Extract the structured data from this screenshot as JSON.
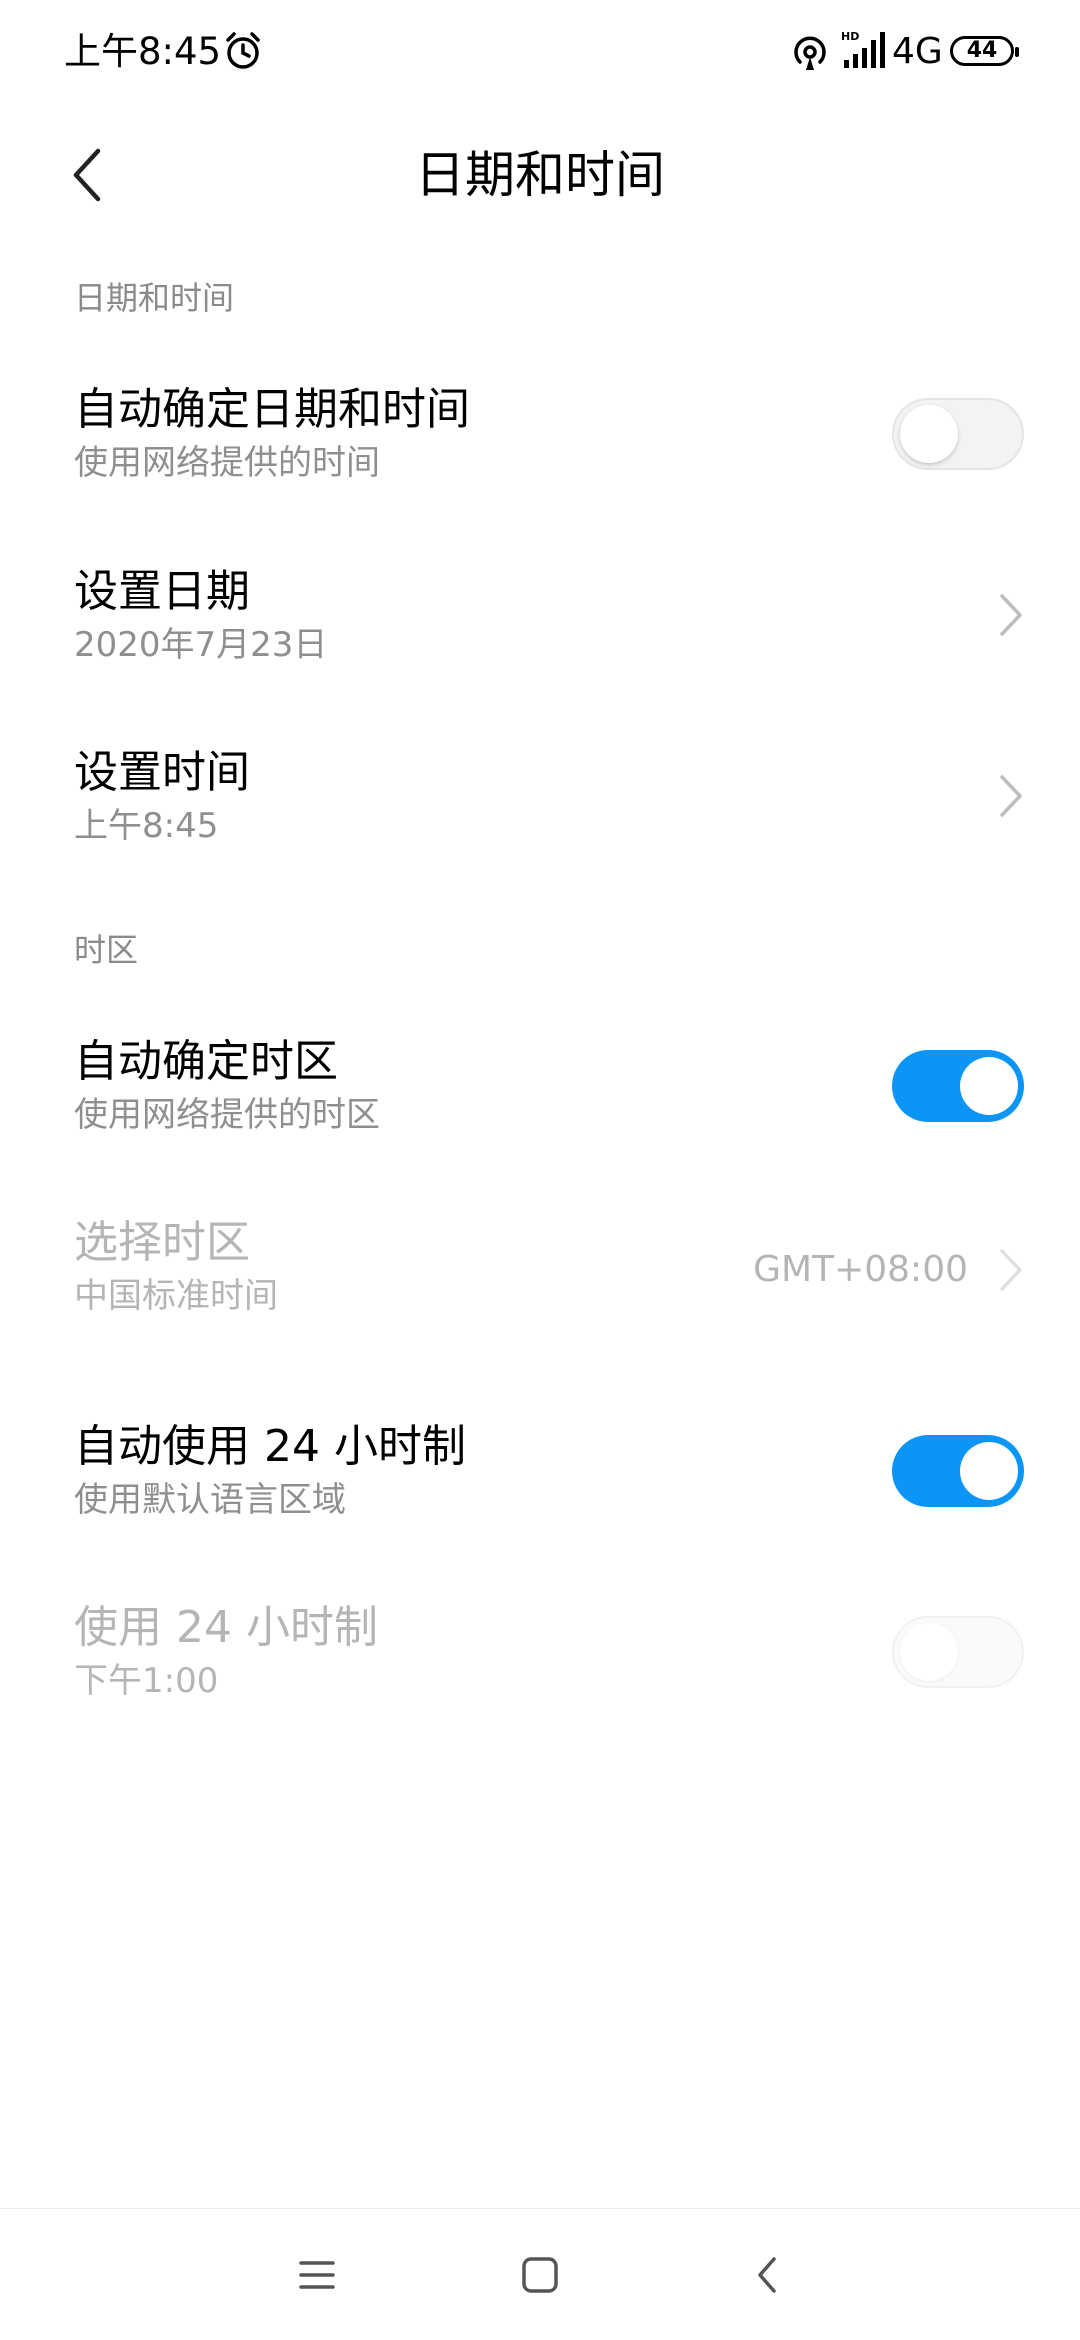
{
  "status_bar": {
    "time": "上午8:45",
    "network_type": "4G",
    "battery_level": "44",
    "icons": [
      "alarm-icon",
      "hotspot-icon",
      "hd-signal-icon"
    ]
  },
  "header": {
    "title": "日期和时间",
    "back_icon": "chevron-left-icon"
  },
  "sections": [
    {
      "label": "日期和时间",
      "items": [
        {
          "title": "自动确定日期和时间",
          "subtitle": "使用网络提供的时间",
          "control": "toggle",
          "toggle_on": false,
          "enabled": true
        },
        {
          "title": "设置日期",
          "subtitle": "2020年7月23日",
          "control": "chevron",
          "enabled": true
        },
        {
          "title": "设置时间",
          "subtitle": "上午8:45",
          "control": "chevron",
          "enabled": true
        }
      ]
    },
    {
      "label": "时区",
      "items": [
        {
          "title": "自动确定时区",
          "subtitle": "使用网络提供的时区",
          "control": "toggle",
          "toggle_on": true,
          "enabled": true
        },
        {
          "title": "选择时区",
          "subtitle": "中国标准时间",
          "value": "GMT+08:00",
          "control": "chevron",
          "enabled": false
        }
      ]
    },
    {
      "label": "",
      "items": [
        {
          "title": "自动使用 24 小时制",
          "subtitle": "使用默认语言区域",
          "control": "toggle",
          "toggle_on": true,
          "enabled": true
        },
        {
          "title": "使用 24 小时制",
          "subtitle": "下午1:00",
          "control": "toggle",
          "toggle_on": false,
          "enabled": false
        }
      ]
    }
  ],
  "nav_bar": {
    "icons": [
      "menu-icon",
      "home-icon",
      "back-icon"
    ]
  },
  "colors": {
    "accent": "#0a95f7",
    "secondary_text": "#8f8f8f",
    "disabled_text": "#b5b5b5"
  }
}
